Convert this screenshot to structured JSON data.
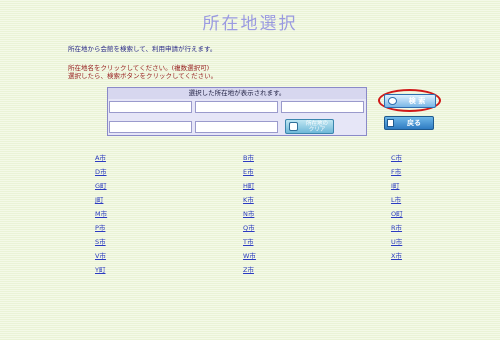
{
  "page": {
    "title": "所在地選択",
    "desc_line1": "所在地から会館を検索して、利用申請が行えます。",
    "desc_line2": "所在地名をクリックしてください。(複数選択可)",
    "desc_line3": "選択したら、検索ボタンをクリックしてください。"
  },
  "selection": {
    "header": "選択した所在地が表示されます。",
    "cells": [
      "",
      "",
      "",
      "",
      ""
    ],
    "clear_label": "所在地の\nクリア"
  },
  "buttons": {
    "search_label": "検 索",
    "back_label": "戻る",
    "search_icon": "search-icon",
    "back_icon": "back-icon"
  },
  "cities": [
    [
      "A市",
      "B市",
      "C市"
    ],
    [
      "D市",
      "E市",
      "F市"
    ],
    [
      "G町",
      "H町",
      "I町"
    ],
    [
      "J町",
      "K市",
      "L市"
    ],
    [
      "M市",
      "N市",
      "O町"
    ],
    [
      "P市",
      "Q市",
      "R市"
    ],
    [
      "S市",
      "T市",
      "U市"
    ],
    [
      "V市",
      "W市",
      "X市"
    ],
    [
      "Y町",
      "Z市",
      ""
    ]
  ],
  "colors": {
    "title": "#9a9ae0",
    "link": "#2a3ac0",
    "highlight": "#d01818"
  }
}
